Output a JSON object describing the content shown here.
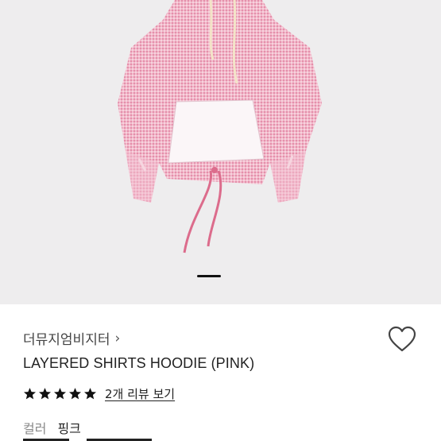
{
  "hero": {
    "image_alt": "Pink gingham layered shirt hoodie with white kangaroo pocket and drawstrings",
    "carousel_position": 1
  },
  "product": {
    "brand": "더뮤지엄비지터",
    "brand_chevron": "›",
    "name": "LAYERED SHIRTS HOODIE (PINK)",
    "rating": 5,
    "review_text": "2개 리뷰 보기"
  },
  "option": {
    "label": "컬러",
    "value": "핑크"
  },
  "icons": {
    "wishlist": "heart-outline-icon",
    "star": "star-filled-icon",
    "chevron": "chevron-right-icon"
  },
  "colors": {
    "hero_bg": "#eeedee",
    "garment_pink": "#f1b6c8",
    "star": "#111111"
  }
}
